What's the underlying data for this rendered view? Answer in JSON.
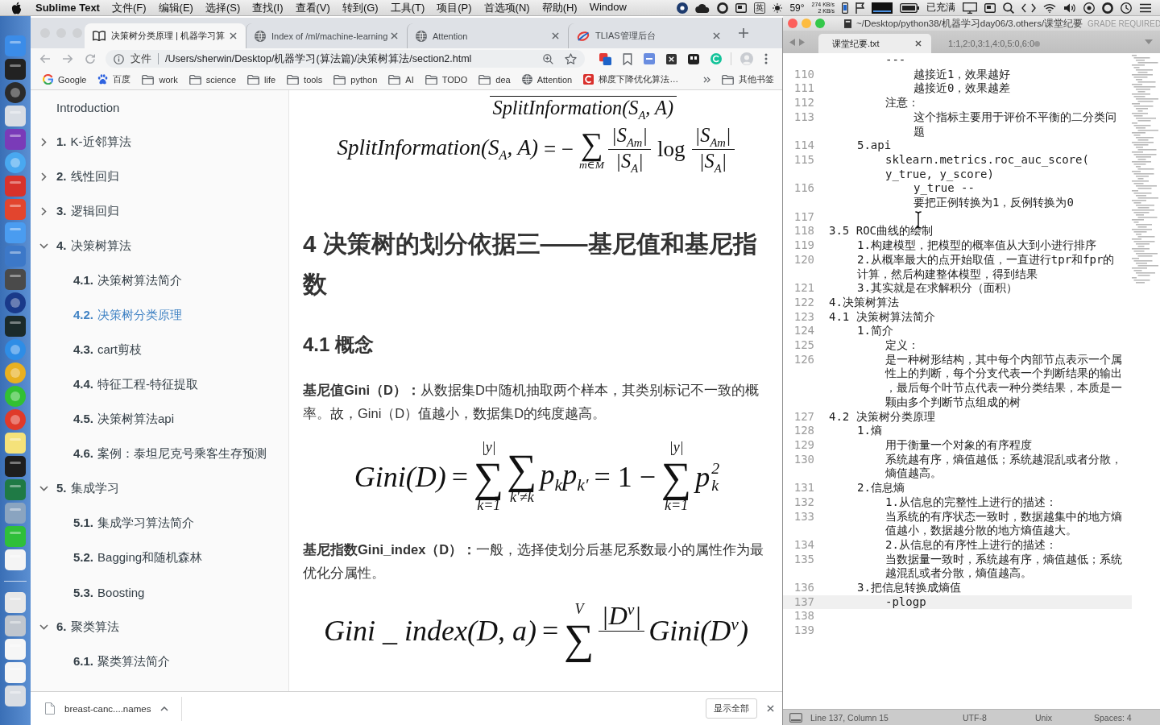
{
  "menu_bar": {
    "app": "Sublime Text",
    "menus": [
      "文件(F)",
      "编辑(E)",
      "选择(S)",
      "查找(I)",
      "查看(V)",
      "转到(G)",
      "工具(T)",
      "项目(P)",
      "首选项(N)",
      "帮助(H)",
      "Window"
    ],
    "input_method": "英",
    "temperature": "59°",
    "net_up": "274 KB/s",
    "net_down": "2 KB/s",
    "battery": "已充满"
  },
  "browser": {
    "tabs": [
      {
        "kind": "book",
        "title": "决策树分类原理 | 机器学习算",
        "selected": true
      },
      {
        "kind": "globe",
        "title": "Index of /ml/machine-learning",
        "selected": false
      },
      {
        "kind": "globe",
        "title": "Attention",
        "selected": false
      },
      {
        "kind": "swirl",
        "title": "TLIAS管理后台",
        "selected": false
      }
    ],
    "address": {
      "scheme": "文件",
      "url": "/Users/sherwin/Desktop/机器学习(算法篇)/决策树算法/section2.html"
    },
    "bookmarks": [
      {
        "kind": "google",
        "label": "Google"
      },
      {
        "kind": "paw",
        "label": "百度"
      },
      {
        "kind": "folder",
        "label": "work"
      },
      {
        "kind": "folder",
        "label": "science"
      },
      {
        "kind": "folder",
        "label": "life"
      },
      {
        "kind": "folder",
        "label": "tools"
      },
      {
        "kind": "folder",
        "label": "python"
      },
      {
        "kind": "folder",
        "label": "AI"
      },
      {
        "kind": "folder",
        "label": "TODO"
      },
      {
        "kind": "folder",
        "label": "dea"
      },
      {
        "kind": "globe",
        "label": "Attention"
      },
      {
        "kind": "site",
        "label": "梯度下降优化算法…"
      }
    ],
    "other_bookmarks": "其他书签",
    "sidebar": [
      {
        "title": "Introduction",
        "selected": false
      },
      {
        "number": "1.",
        "title": "K-近邻算法",
        "expanded": false,
        "selected": false
      },
      {
        "number": "2.",
        "title": "线性回归",
        "expanded": false,
        "selected": false
      },
      {
        "number": "3.",
        "title": "逻辑回归",
        "expanded": false,
        "selected": false
      },
      {
        "number": "4.",
        "title": "决策树算法",
        "expanded": true,
        "selected": false,
        "children": [
          {
            "number": "4.1.",
            "title": "决策树算法简介",
            "selected": false
          },
          {
            "number": "4.2.",
            "title": "决策树分类原理",
            "selected": true
          },
          {
            "number": "4.3.",
            "title": "cart剪枝",
            "selected": false
          },
          {
            "number": "4.4.",
            "title": "特征工程-特征提取",
            "selected": false
          },
          {
            "number": "4.5.",
            "title": "决策树算法api",
            "selected": false
          },
          {
            "number": "4.6.",
            "title": "案例：泰坦尼克号乘客生存预测",
            "selected": false
          }
        ]
      },
      {
        "number": "5.",
        "title": "集成学习",
        "expanded": true,
        "selected": false,
        "children": [
          {
            "number": "5.1.",
            "title": "集成学习算法简介",
            "selected": false
          },
          {
            "number": "5.2.",
            "title": "Bagging和随机森林",
            "selected": false
          },
          {
            "number": "5.3.",
            "title": "Boosting",
            "selected": false
          }
        ]
      },
      {
        "number": "6.",
        "title": "聚类算法",
        "expanded": true,
        "selected": false,
        "children": [
          {
            "number": "6.1.",
            "title": "聚类算法简介",
            "selected": false
          }
        ]
      }
    ],
    "article": [
      {
        "kind": "formula",
        "parts": [
          {
            "kind": "frac",
            "den": "SplitInformation(S$_{A}$, A)"
          }
        ]
      },
      {
        "kind": "formula",
        "parts": [
          {
            "kind": "text",
            "text": "SplitInformation(S$_{A}$, A)"
          },
          {
            "kind": "op",
            "text": "= −"
          },
          {
            "kind": "sum",
            "symbol": "∑",
            "under": "m∈M"
          },
          {
            "kind": "frac",
            "num": "|S$_{Am}$|",
            "den": "|S$_{A}$|"
          },
          {
            "kind": "op",
            "text": "log"
          },
          {
            "kind": "frac",
            "num": "|S$_{Am}$|",
            "den": "|S$_{A}$|"
          }
        ]
      },
      {
        "kind": "heading",
        "text": "4 决策树的划分依据三——基尼值和基尼指数"
      },
      {
        "kind": "subheading",
        "text": "4.1 概念"
      },
      {
        "kind": "paragraph",
        "text": "**基尼值Gini（D）：**从数据集D中随机抽取两个样本，其类别标记不一致的概率。故，Gini（D）值越小，数据集D的纯度越高。"
      },
      {
        "kind": "formula",
        "parts": [
          {
            "kind": "text",
            "text": "Gini(D)"
          },
          {
            "kind": "op",
            "text": "="
          },
          {
            "kind": "sum",
            "symbol": "∑",
            "over": "|y|",
            "under": "k=1"
          },
          {
            "kind": "sum",
            "symbol": "∑",
            "under": "k′≠k"
          },
          {
            "kind": "text",
            "text": "p$_{k}$p$_{k′}$"
          },
          {
            "kind": "op",
            "text": "= 1 −"
          },
          {
            "kind": "sum",
            "symbol": "∑",
            "over": "|y|",
            "under": "k=1"
          },
          {
            "kind": "script",
            "base": "p",
            "sup": "2",
            "sub": "k"
          }
        ]
      },
      {
        "kind": "paragraph",
        "text": "**基尼指数Gini_index（D）：**一般，选择使划分后基尼系数最小的属性作为最优化分属性。"
      },
      {
        "kind": "formula",
        "parts": [
          {
            "kind": "text",
            "text": "Gini _ index(D, a)"
          },
          {
            "kind": "op",
            "text": "="
          },
          {
            "kind": "sum",
            "symbol": "∑",
            "over": "V"
          },
          {
            "kind": "frac",
            "num": "|D$^{v}$|"
          },
          {
            "kind": "text",
            "text": "Gini(D$^{v}$)"
          }
        ]
      }
    ],
    "downloads": {
      "file": "breast-canc....names",
      "show_all": "显示全部"
    }
  },
  "editor": {
    "title": "~/Desktop/python38/机器学习day06/3.others/课堂纪要",
    "notice": "GRADE REQUIRED",
    "tabs": [
      {
        "label": "课堂纪要.txt",
        "selected": true,
        "modified": false
      },
      {
        "label": "1:1,2:0,3:1,4:0,5:0,6:0",
        "selected": false,
        "modified": true
      }
    ],
    "lines": [
      {
        "children": [
          {
            "children": [
              {
                "text": "---",
                "current": false,
                "children": [
                  {
                    "number": "110",
                    "text": "越接近1，效果越好",
                    "current": false
                  },
                  {
                    "number": "111",
                    "text": "越接近0，效果越差",
                    "current": false
                  }
                ]
              },
              {
                "number": "112",
                "text": "注意：",
                "current": false,
                "children": [
                  {
                    "number": "113",
                    "rows": [
                      "这个指标主要用于评价不平衡的二分类问",
                      "题"
                    ],
                    "current": false
                  }
                ]
              }
            ]
          },
          {
            "number": "114",
            "text": "5.api",
            "current": false,
            "children": [
              {
                "number": "115",
                "rows": [
                  "sklearn.metrics.roc_auc_score(",
                  "y_true, y_score)"
                ],
                "current": false,
                "children": [
                  {
                    "number": "116",
                    "rows": [
                      "y_true --",
                      "要把正例转换为1，反例转换为0"
                    ],
                    "current": false
                  }
                ]
              }
            ]
          }
        ]
      },
      {
        "number": "117",
        "current": false
      },
      {
        "number": "118",
        "text": "3.5 ROC曲线的绘制",
        "current": false,
        "children": [
          {
            "number": "119",
            "text": "1.构建模型，把模型的概率值从大到小进行排序",
            "current": false
          },
          {
            "number": "120",
            "rows": [
              "2.从概率最大的点开始取值，一直进行tpr和fpr的",
              "计算，然后构建整体模型，得到结果"
            ],
            "current": false
          },
          {
            "number": "121",
            "text": "3.其实就是在求解积分（面积）",
            "current": false
          }
        ]
      },
      {
        "number": "122",
        "text": "4.决策树算法",
        "current": false
      },
      {
        "number": "123",
        "text": "4.1 决策树算法简介",
        "current": false,
        "children": [
          {
            "number": "124",
            "text": "1.简介",
            "current": false,
            "children": [
              {
                "number": "125",
                "text": "定义：",
                "current": false
              },
              {
                "number": "126",
                "rows": [
                  "是一种树形结构，其中每个内部节点表示一个属",
                  "性上的判断，每个分支代表一个判断结果的输出",
                  "，最后每个叶节点代表一种分类结果，本质是一",
                  "颗由多个判断节点组成的树"
                ],
                "current": false
              }
            ]
          }
        ]
      },
      {
        "number": "127",
        "text": "4.2 决策树分类原理",
        "current": false,
        "children": [
          {
            "number": "128",
            "text": "1.熵",
            "current": false,
            "children": [
              {
                "number": "129",
                "text": "用于衡量一个对象的有序程度",
                "current": false
              },
              {
                "number": "130",
                "rows": [
                  "系统越有序，熵值越低；系统越混乱或者分散，",
                  "熵值越高。"
                ],
                "current": false
              }
            ]
          },
          {
            "number": "131",
            "text": "2.信息熵",
            "current": false,
            "children": [
              {
                "number": "132",
                "text": "1.从信息的完整性上进行的描述：",
                "current": false
              },
              {
                "number": "133",
                "rows": [
                  "当系统的有序状态一致时，数据越集中的地方熵",
                  "值越小，数据越分散的地方熵值越大。"
                ],
                "current": false
              },
              {
                "number": "134",
                "text": "2.从信息的有序性上进行的描述：",
                "current": false
              },
              {
                "number": "135",
                "rows": [
                  "当数据量一致时，系统越有序，熵值越低；系统",
                  "越混乱或者分散，熵值越高。"
                ],
                "current": false
              }
            ]
          },
          {
            "number": "136",
            "text": "3.把信息转换成熵值",
            "current": false,
            "children": [
              {
                "number": "137",
                "text": "-plogp",
                "current": true
              }
            ]
          }
        ]
      },
      {
        "number": "138",
        "current": false
      },
      {
        "number": "139",
        "current": false
      }
    ],
    "status": {
      "position": "Line 137, Column 15",
      "encoding": "UTF-8",
      "line_endings": "Unix",
      "indentation": "Spaces: 4"
    }
  }
}
